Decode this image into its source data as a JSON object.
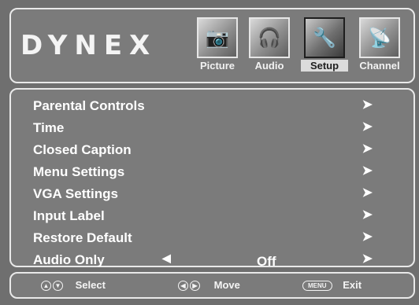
{
  "brand": "DYNEX",
  "tabs": [
    {
      "label": "Picture",
      "icon": "camera-icon"
    },
    {
      "label": "Audio",
      "icon": "headphones-icon"
    },
    {
      "label": "Setup",
      "icon": "tools-icon",
      "active": true
    },
    {
      "label": "Channel",
      "icon": "satellite-icon"
    }
  ],
  "menu": {
    "items": [
      {
        "label": "Parental Controls"
      },
      {
        "label": "Time"
      },
      {
        "label": "Closed Caption"
      },
      {
        "label": "Menu Settings"
      },
      {
        "label": "VGA Settings"
      },
      {
        "label": "Input Label"
      },
      {
        "label": "Restore Default"
      },
      {
        "label": "Audio Only",
        "value": "Off"
      }
    ]
  },
  "footer": {
    "select": "Select",
    "move": "Move",
    "menu_key": "MENU",
    "exit": "Exit"
  }
}
